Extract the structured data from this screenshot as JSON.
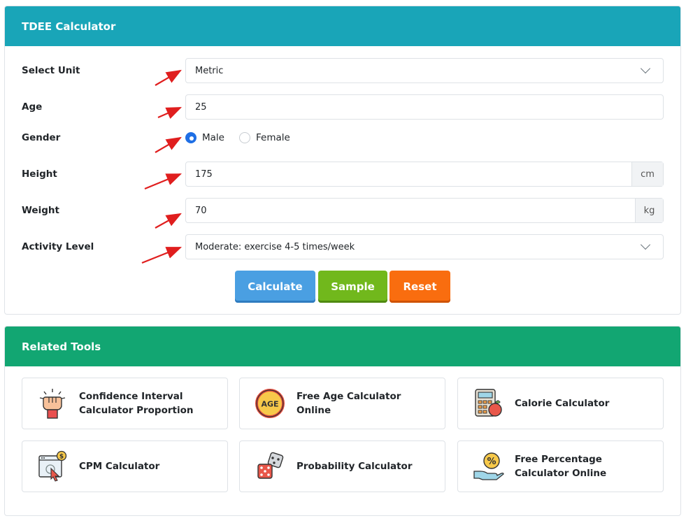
{
  "calculator": {
    "title": "TDEE Calculator",
    "unit": {
      "label": "Select Unit",
      "value": "Metric"
    },
    "age": {
      "label": "Age",
      "value": "25"
    },
    "gender": {
      "label": "Gender",
      "options": [
        "Male",
        "Female"
      ],
      "selected": "Male"
    },
    "height": {
      "label": "Height",
      "value": "175",
      "unit": "cm"
    },
    "weight": {
      "label": "Weight",
      "value": "70",
      "unit": "kg"
    },
    "activity": {
      "label": "Activity Level",
      "value": "Moderate: exercise 4-5 times/week"
    },
    "buttons": {
      "calculate": "Calculate",
      "sample": "Sample",
      "reset": "Reset"
    }
  },
  "related": {
    "title": "Related Tools",
    "tools": [
      {
        "label": "Confidence Interval Calculator Proportion",
        "icon": "raised-fist-icon"
      },
      {
        "label": "Free Age Calculator Online",
        "icon": "age-badge-icon"
      },
      {
        "label": "Calorie Calculator",
        "icon": "calculator-apple-icon"
      },
      {
        "label": "CPM Calculator",
        "icon": "browser-dollar-click-icon"
      },
      {
        "label": "Probability Calculator",
        "icon": "dice-icon"
      },
      {
        "label": "Free Percentage Calculator Online",
        "icon": "hand-percent-coin-icon"
      }
    ]
  },
  "colors": {
    "calc_header": "#19a5b8",
    "tools_header": "#12a672",
    "calculate_btn": "#4a9fe2",
    "sample_btn": "#71b81c",
    "reset_btn": "#f96d0f",
    "annotation_arrow": "#e01e1e"
  }
}
